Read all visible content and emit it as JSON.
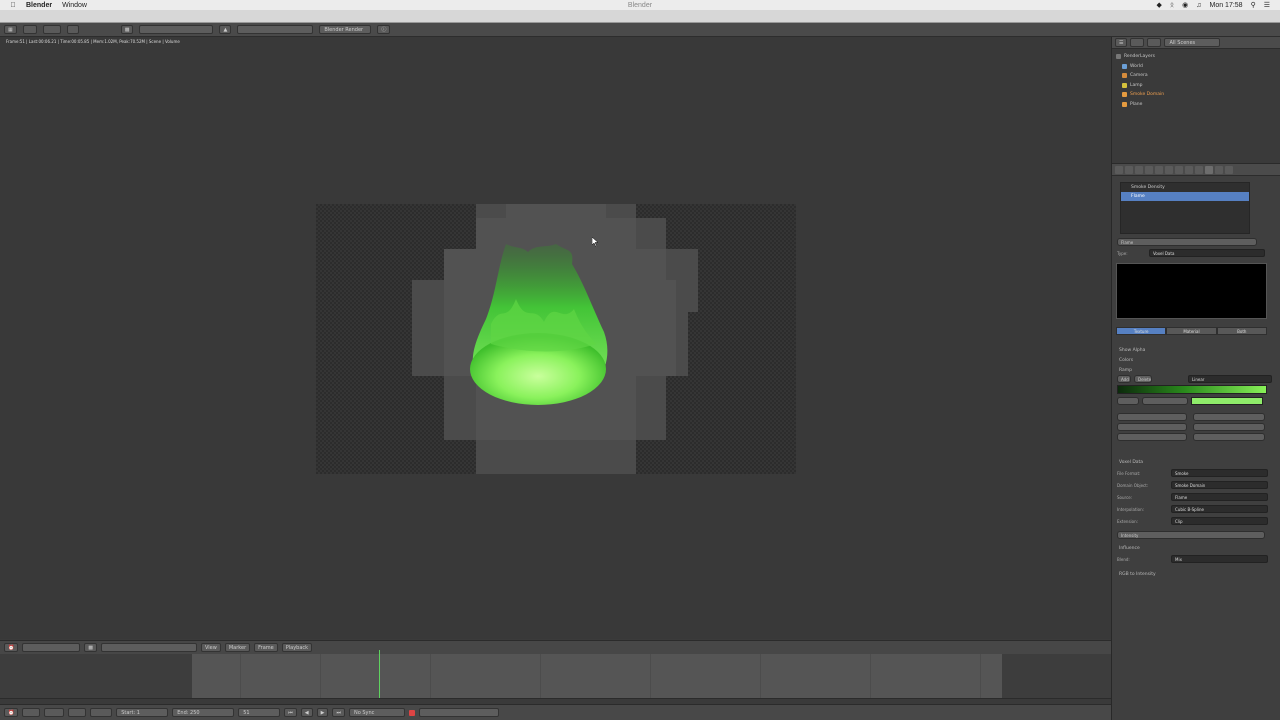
{
  "menubar": {
    "app_name": "Blender",
    "menu_window": "Window",
    "window_title": "Blender",
    "clock": "Mon 17:58"
  },
  "info_header": {
    "render_engine": "Blender Render"
  },
  "viewport": {
    "render_stats": "Frame:51 | Last:00:06.21 | Time:00:05.85 | Mem:1.02M, Peak:70.52M | Scene | Volume"
  },
  "outliner": {
    "view_option": "All Scenes",
    "items": [
      "RenderLayers",
      "World",
      "Camera",
      "Lamp",
      "Smoke Domain",
      "Plane"
    ]
  },
  "properties": {
    "texture_slots": [
      "Smoke Density",
      "Flame"
    ],
    "texture_name": "Flame",
    "type_label": "Type:",
    "type_value": "Voxel Data",
    "preview_tabs": [
      "Texture",
      "Material",
      "Both"
    ],
    "show_alpha": "Show Alpha",
    "colors_label": "Colors",
    "ramp_label": "Ramp",
    "ramp_interp": "Linear",
    "ramp_buttons": [
      "Add",
      "Delete"
    ],
    "voxel_section": "Voxel Data",
    "file_format_label": "File Format:",
    "file_format": "Smoke",
    "domain_object_label": "Domain Object:",
    "domain_object": "Smoke Domain",
    "source_label": "Source:",
    "source": "Flame",
    "interpolation_label": "Interpolation:",
    "interpolation": "Cubic B-Spline",
    "extension_label": "Extension:",
    "extension": "Clip",
    "intensity_label": "Intensity",
    "influence_section": "Influence",
    "blend_label": "Blend:",
    "blend": "Mix",
    "rgb_to_intensity": "RGB to Intensity"
  },
  "timeline": {
    "view_btn": "View",
    "marker_btn": "Marker",
    "frame_btn": "Frame",
    "playback_btn": "Playback",
    "start_label": "Start: 1",
    "end_label": "End: 250",
    "current_frame": "51",
    "sync": "No Sync"
  }
}
